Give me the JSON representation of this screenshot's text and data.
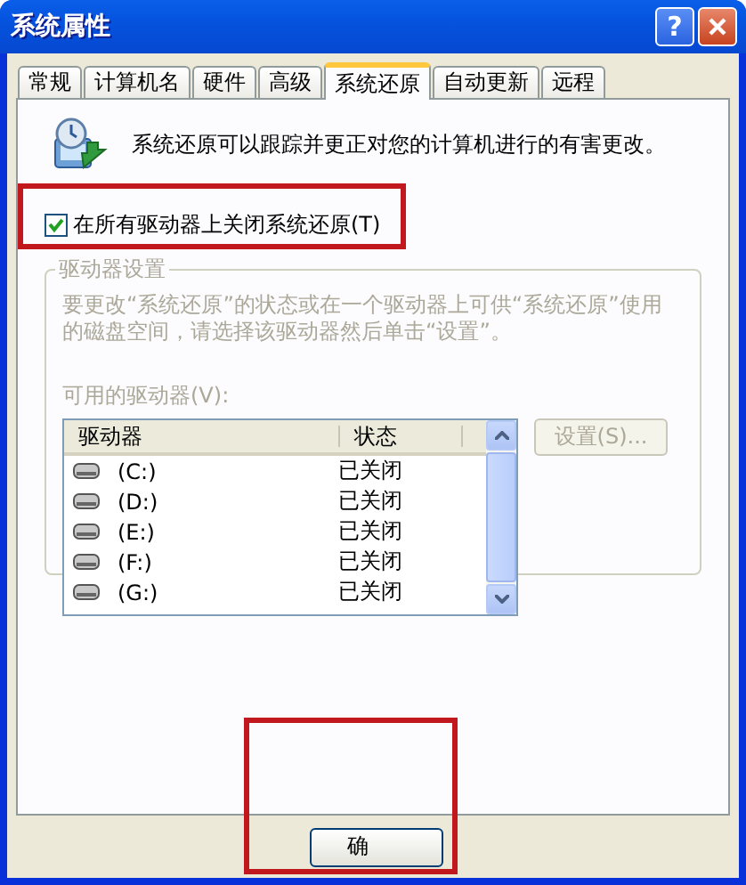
{
  "window": {
    "title": "系统属性",
    "help": "?"
  },
  "tabs": [
    {
      "label": "常规",
      "selected": false
    },
    {
      "label": "计算机名",
      "selected": false
    },
    {
      "label": "硬件",
      "selected": false
    },
    {
      "label": "高级",
      "selected": false
    },
    {
      "label": "系统还原",
      "selected": true
    },
    {
      "label": "自动更新",
      "selected": false
    },
    {
      "label": "远程",
      "selected": false
    }
  ],
  "intro": "系统还原可以跟踪并更正对您的计算机进行的有害更改。",
  "turn_off_checkbox": {
    "label": "在所有驱动器上关闭系统还原(T)",
    "checked": true
  },
  "drive_settings": {
    "title": "驱动器设置",
    "disabled": true,
    "description": "要更改“系统还原”的状态或在一个驱动器上可供“系统还原”使用的磁盘空间，请选择该驱动器然后单击“设置”。",
    "list_label": "可用的驱动器(V):",
    "columns": [
      "驱动器",
      "状态"
    ],
    "rows": [
      {
        "drive": "(C:)",
        "status": "已关闭"
      },
      {
        "drive": "(D:)",
        "status": "已关闭"
      },
      {
        "drive": "(E:)",
        "status": "已关闭"
      },
      {
        "drive": "(F:)",
        "status": "已关闭"
      },
      {
        "drive": "(G:)",
        "status": "已关闭"
      }
    ],
    "settings_button": {
      "label": "设置(S)...",
      "disabled": true
    }
  },
  "buttons": [
    {
      "label": "确"
    }
  ]
}
